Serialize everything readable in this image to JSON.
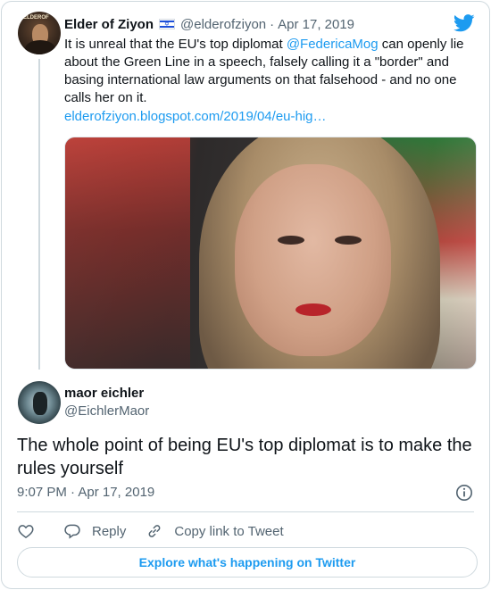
{
  "parent_tweet": {
    "author_name": "Elder of Ziyon",
    "author_flag": "israel-flag-icon",
    "handle": "@elderofziyon",
    "separator": "·",
    "date": "Apr 17, 2019",
    "text_before": "It is unreal that the EU's top diplomat ",
    "mention": "@FedericaMog",
    "text_after": " can openly lie about the Green Line in a speech, falsely calling it a \"border\" and basing international law arguments on that falsehood - and no one calls her on it.",
    "link": "elderofziyon.blogspot.com/2019/04/eu-hig…",
    "avatar_label": "ELDEROF"
  },
  "main_tweet": {
    "author_name": "maor eichler",
    "handle": "@EichlerMaor",
    "text": "The whole point of being EU's top diplomat is to make the rules yourself",
    "timestamp": "9:07 PM · Apr 17, 2019"
  },
  "actions": {
    "reply_label": "Reply",
    "copy_label": "Copy link to Tweet"
  },
  "explore_label": "Explore what's happening on Twitter",
  "colors": {
    "accent": "#1d9bf0",
    "text_primary": "#0f1419",
    "text_secondary": "#536471",
    "border": "#cfd9de"
  }
}
